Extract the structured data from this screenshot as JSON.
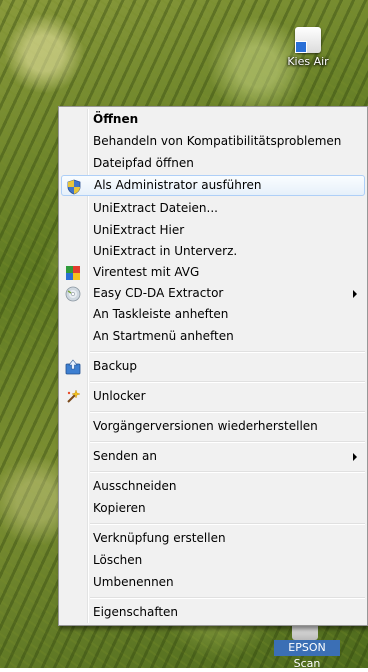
{
  "desktop": {
    "icons": [
      {
        "label": "Kies Air"
      },
      {
        "label": "EPSON Scan"
      }
    ]
  },
  "context_menu": {
    "items": [
      {
        "label": "Öffnen",
        "bold": true
      },
      {
        "label": "Behandeln von Kompatibilitätsproblemen"
      },
      {
        "label": "Dateipfad öffnen"
      },
      {
        "label": "Als Administrator ausführen",
        "icon": "uac-shield-icon",
        "highlighted": true
      },
      {
        "label": "UniExtract Dateien..."
      },
      {
        "label": "UniExtract Hier"
      },
      {
        "label": "UniExtract in Unterverz."
      },
      {
        "label": "Virentest mit AVG",
        "icon": "avg-icon"
      },
      {
        "label": "Easy CD-DA Extractor",
        "icon": "cd-icon",
        "submenu": true
      },
      {
        "label": "An Taskleiste anheften"
      },
      {
        "label": "An Startmenü anheften"
      },
      {
        "label": "Backup",
        "icon": "backup-icon"
      },
      {
        "label": "Unlocker",
        "icon": "unlocker-wand-icon"
      },
      {
        "label": "Vorgängerversionen wiederherstellen"
      },
      {
        "label": "Senden an",
        "submenu": true
      },
      {
        "label": "Ausschneiden"
      },
      {
        "label": "Kopieren"
      },
      {
        "label": "Verknüpfung erstellen"
      },
      {
        "label": "Löschen"
      },
      {
        "label": "Umbenennen"
      },
      {
        "label": "Eigenschaften"
      }
    ]
  },
  "colors": {
    "menu_background": "#f1f1f1",
    "highlight_border": "#aecff7",
    "highlight_fill": "#e6f0fa"
  }
}
